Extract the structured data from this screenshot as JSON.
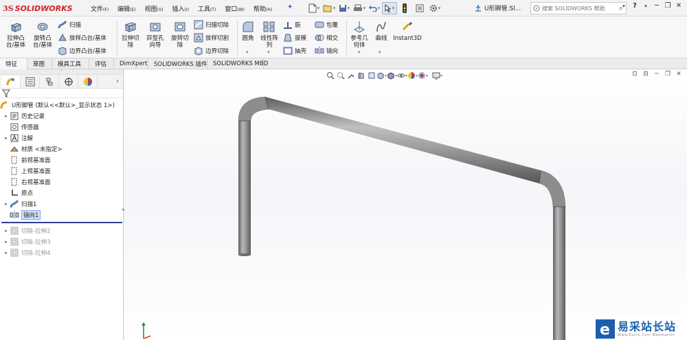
{
  "app": {
    "logo_ds": "3S",
    "logo_name": "SOLIDWORKS"
  },
  "menu": [
    {
      "label": "文件",
      "key": "(F)"
    },
    {
      "label": "编辑",
      "key": "(E)"
    },
    {
      "label": "视图",
      "key": "(V)"
    },
    {
      "label": "插入",
      "key": "(I)"
    },
    {
      "label": "工具",
      "key": "(T)"
    },
    {
      "label": "窗口",
      "key": "(W)"
    },
    {
      "label": "帮助",
      "key": "(H)"
    }
  ],
  "document_title": "U形脚管.Sl...",
  "search": {
    "placeholder": "搜索 SOLIDWORKS 帮助"
  },
  "ribbon": {
    "extrude_boss": "拉伸凸\n台/基体",
    "revolve_boss": "旋转凸\n台/基体",
    "sweep": "扫描",
    "loft_boss": "放样凸台/基体",
    "boundary_boss": "边界凸台/基体",
    "extrude_cut": "拉伸切\n除",
    "hole_wizard": "异型孔\n向导",
    "revolve_cut": "旋转切\n除",
    "sweep_cut": "扫描切除",
    "loft_cut": "放样切割",
    "boundary_cut": "边界切除",
    "fillet": "圆角",
    "linear_pattern": "线性阵\n列",
    "rib": "筋",
    "draft": "拔模",
    "shell": "抽壳",
    "wrap": "包覆",
    "intersect": "相交",
    "mirror": "镜向",
    "reference_geometry": "参考几\n何体",
    "curves": "曲线",
    "instant3d": "Instant3D"
  },
  "tabs": [
    "特征",
    "草图",
    "模具工具",
    "评估",
    "DimXpert",
    "SOLIDWORKS 插件",
    "SOLIDWORKS MBD"
  ],
  "tree": {
    "root": "U形脚管  (默认<<默认>_显示状态 1>)",
    "items": [
      {
        "label": "历史记录",
        "expand": "▸"
      },
      {
        "label": "传感器",
        "expand": ""
      },
      {
        "label": "注解",
        "expand": "▸"
      },
      {
        "label": "材质 <未指定>",
        "expand": ""
      },
      {
        "label": "前视基准面",
        "expand": ""
      },
      {
        "label": "上视基准面",
        "expand": ""
      },
      {
        "label": "右视基准面",
        "expand": ""
      },
      {
        "label": "原点",
        "expand": ""
      },
      {
        "label": "扫描1",
        "expand": "▸"
      },
      {
        "label": "镜向1",
        "expand": ""
      },
      {
        "label": "切除-拉伸2",
        "expand": "▸"
      },
      {
        "label": "切除-拉伸3",
        "expand": "▸"
      },
      {
        "label": "切除-拉伸4",
        "expand": "▸"
      }
    ]
  },
  "watermark": {
    "title": "易采站长站",
    "subtitle": "Www.Easck.Com  Webmaster"
  },
  "colors": {
    "accent": "#2e3f8f",
    "brand_red": "#d2232a",
    "watermark_blue": "#1d5fae",
    "pipe": "#8a8a8a"
  }
}
